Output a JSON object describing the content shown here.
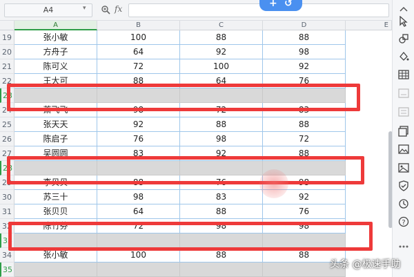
{
  "formula_bar": {
    "cell_ref": "A4",
    "fx": "fx"
  },
  "columns": [
    {
      "label": "A",
      "selected": true
    },
    {
      "label": "B",
      "selected": false
    },
    {
      "label": "C",
      "selected": false
    },
    {
      "label": "D",
      "selected": false
    },
    {
      "label": "E",
      "selected": false
    }
  ],
  "rows": [
    {
      "num": "19",
      "name": "张小敏",
      "b": "100",
      "c": "88",
      "d": "88",
      "blank": false
    },
    {
      "num": "20",
      "name": "方舟子",
      "b": "64",
      "c": "92",
      "d": "98",
      "blank": false
    },
    {
      "num": "21",
      "name": "陈可义",
      "b": "72",
      "c": "100",
      "d": "92",
      "blank": false
    },
    {
      "num": "22",
      "name": "王大可",
      "b": "88",
      "c": "64",
      "d": "76",
      "blank": false
    },
    {
      "num": "23",
      "name": "",
      "b": "",
      "c": "",
      "d": "",
      "blank": true
    },
    {
      "num": "24",
      "name": "萧飞飞",
      "b": "98",
      "c": "72",
      "d": "83",
      "blank": false
    },
    {
      "num": "25",
      "name": "张天天",
      "b": "92",
      "c": "88",
      "d": "88",
      "blank": false
    },
    {
      "num": "26",
      "name": "陈启子",
      "b": "76",
      "c": "98",
      "d": "72",
      "blank": false
    },
    {
      "num": "27",
      "name": "吴圆圆",
      "b": "83",
      "c": "92",
      "d": "88",
      "blank": false
    },
    {
      "num": "28",
      "name": "",
      "b": "",
      "c": "",
      "d": "",
      "blank": true
    },
    {
      "num": "29",
      "name": "李贝贝",
      "b": "88",
      "c": "76",
      "d": "98",
      "blank": false
    },
    {
      "num": "30",
      "name": "苏三十",
      "b": "98",
      "c": "83",
      "d": "92",
      "blank": false
    },
    {
      "num": "31",
      "name": "张贝贝",
      "b": "64",
      "c": "88",
      "d": "76",
      "blank": false
    },
    {
      "num": "32",
      "name": "陈竹芬",
      "b": "72",
      "c": "98",
      "d": "98",
      "blank": false
    },
    {
      "num": "33",
      "name": "",
      "b": "",
      "c": "",
      "d": "",
      "blank": true
    },
    {
      "num": "34",
      "name": "张小敏",
      "b": "100",
      "c": "88",
      "d": "88",
      "blank": false
    },
    {
      "num": "35",
      "name": "",
      "b": "",
      "c": "",
      "d": "",
      "blank": true
    }
  ],
  "colors": {
    "highlight": "#ee3a3a",
    "grid": "#9ec6ea",
    "blank_fill": "#d9d9d9",
    "selection": "#2e9d47"
  },
  "toolbar_icons": [
    "cursor-icon",
    "shapes-icon",
    "fill-icon",
    "table-icon",
    "chart-icon",
    "checklist-icon",
    "gallery-icon",
    "image-icon",
    "shield-icon",
    "history-icon",
    "help-icon",
    "more-icon"
  ],
  "watermark": "头条 @极速手助"
}
